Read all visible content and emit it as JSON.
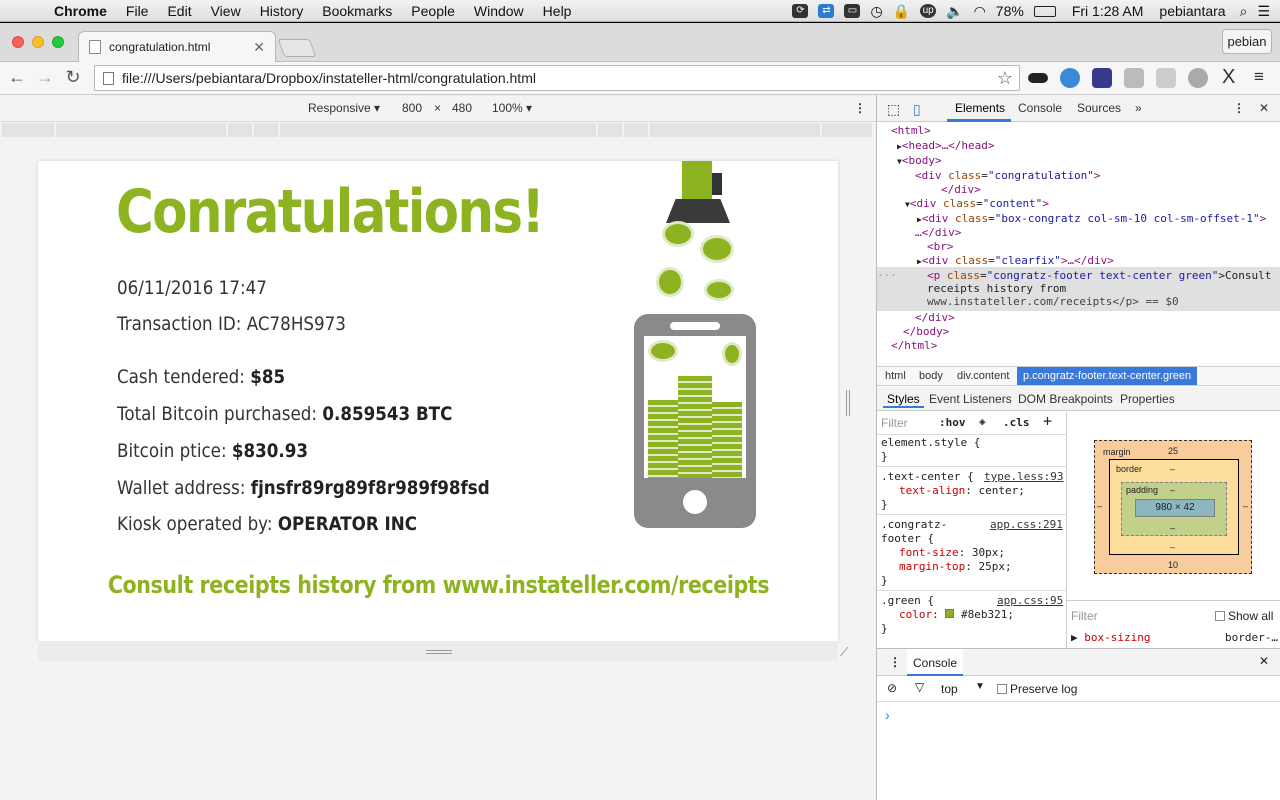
{
  "menubar": {
    "app": "Chrome",
    "items": [
      "File",
      "Edit",
      "View",
      "History",
      "Bookmarks",
      "People",
      "Window",
      "Help"
    ],
    "battery": "78%",
    "clock": "Fri 1:28 AM",
    "user": "pebiantara"
  },
  "tabbar": {
    "tab_title": "congratulation.html",
    "profile": "pebian"
  },
  "toolbar": {
    "url": "file:///Users/pebiantara/Dropbox/instateller-html/congratulation.html"
  },
  "device_toolbar": {
    "mode": "Responsive",
    "width": "800",
    "times": "×",
    "height": "480",
    "zoom": "100%"
  },
  "page": {
    "heading": "Conratulations!",
    "date": "06/11/2016 17:47",
    "transaction": "Transaction ID: AC78HS973",
    "cash_label": "Cash tendered: ",
    "cash_value": "$85",
    "btc_label": "Total Bitcoin purchased: ",
    "btc_value": "0.859543 BTC",
    "price_label": "Bitcoin ptice: ",
    "price_value": "$830.93",
    "wallet_label": "Wallet address: ",
    "wallet_value": "fjnsfr89rg89f8r989f98fsd",
    "kiosk_label": "Kiosk operated by: ",
    "kiosk_value": "OPERATOR INC",
    "footer": "Consult receipts history from www.instateller.com/receipts"
  },
  "devtools": {
    "tabs": [
      "Elements",
      "Console",
      "Sources"
    ],
    "dom": {
      "l1": "<html>",
      "l2": "<head>…</head>",
      "l3": "<body>",
      "l4a": "<div ",
      "l4b": "class",
      "l4c": "\"congratulation\"",
      "l4d": ">",
      "l5": "</div>",
      "l6c": "\"content\"",
      "l7c": "\"box-congratz col-sm-10 col-sm-offset-1\"",
      "l8": "…</div>",
      "l9": "<br>",
      "l10c": "\"clearfix\"",
      "l10d": ">…</div>",
      "l11a": "<p ",
      "l11c": "\"congratz-footer text-center green\"",
      "l11d": ">Consult",
      "l12": "receipts history from",
      "l13": "www.instateller.com/receipts</p> == $0",
      "l14": "</div>",
      "l15": "</body>",
      "l16": "</html>"
    },
    "breadcrumbs": [
      "html",
      "body",
      "div.content",
      "p.congratz-footer.text-center.green"
    ],
    "subtabs": [
      "Styles",
      "Event Listeners",
      "DOM Breakpoints",
      "Properties"
    ],
    "filter": "Filter",
    "hov": ":hov",
    "cls": ".cls",
    "styles": {
      "r1": "element.style {",
      "close": "}",
      "r2sel": ".text-center {",
      "r2src": "type.less:93",
      "r2prop": "text-align",
      "r2val": ": center;",
      "r3sel": ".congratz-",
      "r3sel2": "footer {",
      "r3src": "app.css:291",
      "r3p1": "font-size",
      "r3v1": ": 30px;",
      "r3p2": "margin-top",
      "r3v2": ": 25px;",
      "r4sel": ".green {",
      "r4src": "app.css:95",
      "r4prop": "color",
      "r4val": "#8eb321;"
    },
    "boxmodel": {
      "margin": "margin",
      "margin_top": "25",
      "margin_bottom": "10",
      "border": "border",
      "padding": "padding",
      "dash": "–",
      "content": "980 × 42"
    },
    "computed_filter": "Filter",
    "show_all": "Show all",
    "computed_prop": "box-sizing",
    "computed_val": "border-…",
    "console_tab": "Console",
    "console_context": "top",
    "preserve_log": "Preserve log"
  },
  "colors": {
    "accent": "#8eb321",
    "devtools_blue": "#3879d9"
  }
}
